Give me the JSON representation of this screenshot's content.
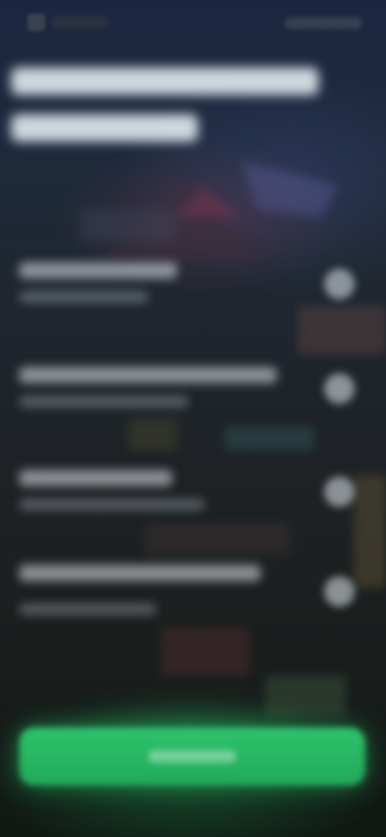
{
  "header": {
    "logo_icon": "app-logo-icon",
    "app_name": "",
    "top_right_action": ""
  },
  "headline": {
    "line_1": "",
    "line_2": ""
  },
  "options": [
    {
      "title": "",
      "subtitle": "",
      "icon": "radio-circle-icon"
    },
    {
      "title": "",
      "subtitle": "",
      "icon": "radio-circle-icon"
    },
    {
      "title": "",
      "subtitle": "",
      "icon": "radio-circle-icon"
    },
    {
      "title": "",
      "subtitle": "",
      "icon": "radio-circle-icon"
    }
  ],
  "cta": {
    "label": ""
  },
  "colors": {
    "background_top": "#1b2740",
    "background_bottom": "#101813",
    "accent_green": "#2ec26b",
    "text_light": "#e9edf2"
  }
}
